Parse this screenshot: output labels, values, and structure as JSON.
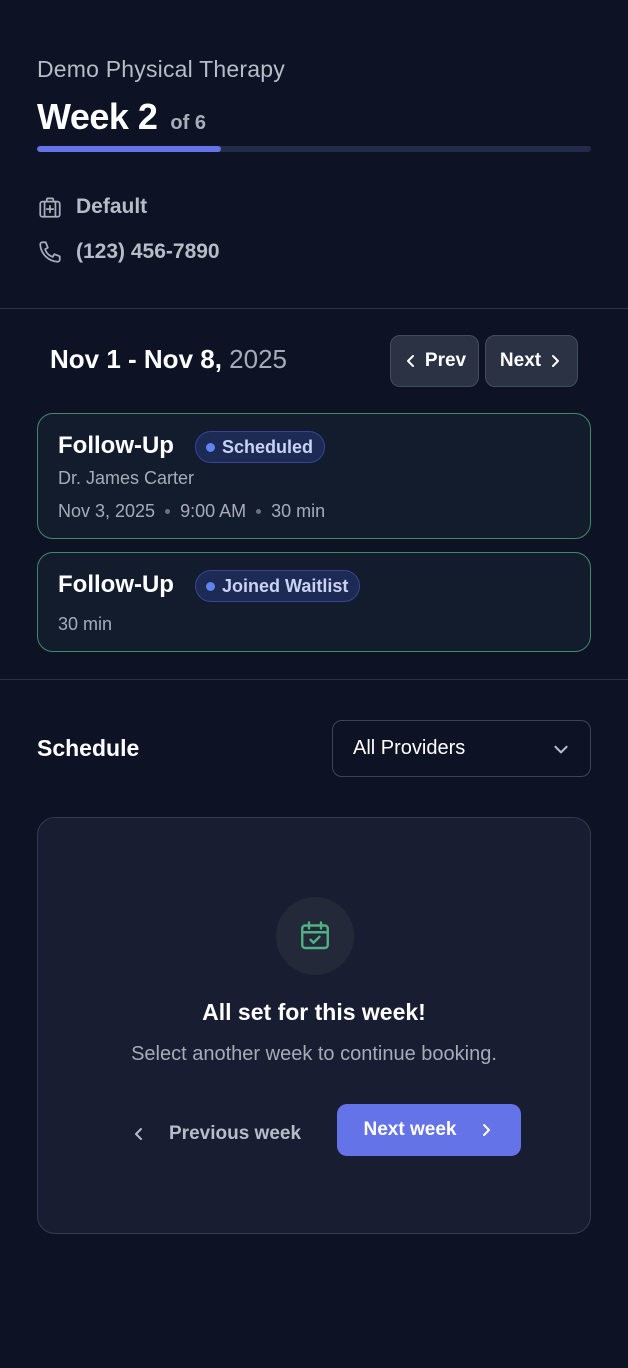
{
  "header": {
    "clinic_name": "Demo Physical Therapy",
    "week_label": "Week 2",
    "week_of": "of 6",
    "progress_fraction": 0.333,
    "location": "Default",
    "phone": "(123) 456-7890"
  },
  "range": {
    "dates": "Nov 1 - Nov 8,",
    "year": "2025",
    "prev_label": "Prev",
    "next_label": "Next"
  },
  "appointments": [
    {
      "title": "Follow-Up",
      "status": "Scheduled",
      "provider": "Dr. James Carter",
      "date": "Nov 3, 2025",
      "time": "9:00 AM",
      "duration": "30 min"
    },
    {
      "title": "Follow-Up",
      "status": "Joined Waitlist",
      "duration": "30 min"
    }
  ],
  "schedule": {
    "title": "Schedule",
    "provider_filter": "All Providers",
    "empty_title": "All set for this week!",
    "empty_subtitle": "Select another week to continue booking.",
    "prev_week_label": "Previous week",
    "next_week_label": "Next week"
  },
  "colors": {
    "background": "#0d1324",
    "accent": "#6474e8",
    "card_border_green": "#3f8a6a",
    "badge_dot": "#5e84f0"
  },
  "icons": {
    "location": "medical-bag-icon",
    "phone": "phone-icon",
    "empty_state": "calendar-check-icon"
  }
}
